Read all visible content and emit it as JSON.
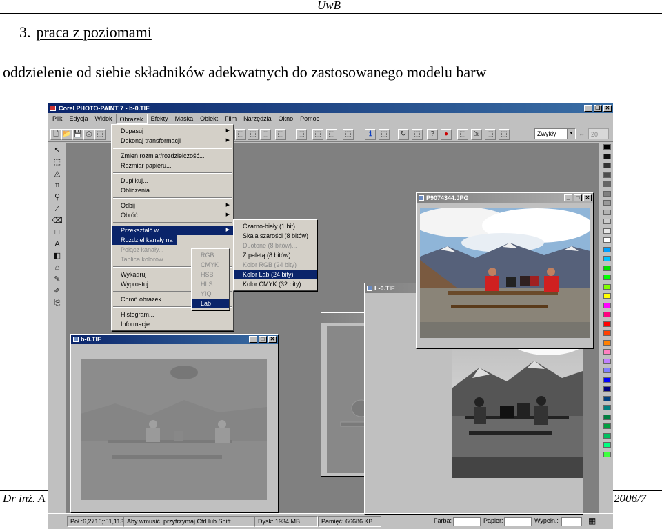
{
  "slide": {
    "header": "UwB",
    "section_number": "3.",
    "section_title": "praca z poziomami",
    "subtitle": "oddzielenie od siebie składników adekwatnych do zastosowanego modelu barw",
    "footer_left": "Dr inż. A",
    "footer_right": "2006/7"
  },
  "app": {
    "title": "Corel PHOTO-PAINT 7 - b-0.TIF",
    "menus": [
      "Plik",
      "Edycja",
      "Widok",
      "Obrazek",
      "Efekty",
      "Maska",
      "Obiekt",
      "Film",
      "Narzędzia",
      "Okno",
      "Pomoc"
    ],
    "active_menu": "Obrazek",
    "zoom_value": "Zwykły",
    "mask_field_value": "20"
  },
  "image_menu": {
    "groups": [
      [
        {
          "label": "Dopasuj",
          "submenu": true
        },
        {
          "label": "Dokonaj transformacji",
          "submenu": true
        }
      ],
      [
        {
          "label": "Zmień rozmiar/rozdzielczość..."
        },
        {
          "label": "Rozmiar papieru..."
        }
      ],
      [
        {
          "label": "Duplikuj..."
        },
        {
          "label": "Obliczenia..."
        }
      ],
      [
        {
          "label": "Odbij",
          "submenu": true
        },
        {
          "label": "Obróć",
          "submenu": true
        }
      ],
      [
        {
          "label": "Przekształć w",
          "submenu": true,
          "highlighted": true
        },
        {
          "label": "Rozdziel kanały na",
          "highlighted": true
        },
        {
          "label": "Połącz kanały...",
          "disabled": true
        },
        {
          "label": "Tablica kolorów...",
          "disabled": true
        }
      ],
      [
        {
          "label": "Wykadruj"
        },
        {
          "label": "Wyprostuj"
        }
      ],
      [
        {
          "label": "Chroń obrazek"
        }
      ],
      [
        {
          "label": "Histogram..."
        },
        {
          "label": "Informacje..."
        }
      ]
    ]
  },
  "split_submenu": {
    "items": [
      {
        "label": "RGB",
        "disabled": true
      },
      {
        "label": "CMYK",
        "disabled": true
      },
      {
        "label": "HSB",
        "disabled": true
      },
      {
        "label": "HLS",
        "disabled": true
      },
      {
        "label": "YIQ",
        "disabled": true
      },
      {
        "label": "Lab",
        "highlighted": true
      }
    ]
  },
  "convert_submenu": {
    "items": [
      {
        "label": "Czarno-biały (1 bit)"
      },
      {
        "label": "Skala szarości (8 bitów)"
      },
      {
        "label": "Duotone (8 bitów)...",
        "disabled": true
      },
      {
        "label": "Z paletą (8 bitów)..."
      },
      {
        "label": "Kolor RGB (24 bity)",
        "disabled": true
      },
      {
        "label": "Kolor Lab (24 bity)",
        "highlighted": true
      },
      {
        "label": "Kolor CMYK (32 bity)"
      }
    ]
  },
  "documents": {
    "photo": {
      "title": "P9074344.JPG"
    },
    "l_channel": {
      "title": "L-0.TIF"
    },
    "a_channel": {
      "title": ""
    },
    "b_channel": {
      "title": "b-0.TIF"
    }
  },
  "status": {
    "position": "Poł.:6,2716;:51,1136",
    "hint": "Aby wmusić, przytrzymaj Ctrl lub Shift",
    "disk": "Dysk: 1934 MB",
    "memory": "Pamięć: 66686 KB",
    "fill_label": "Farba:",
    "paper_label": "Papier:",
    "outline_label": "Wypełn.:"
  },
  "palette_colors": [
    "#000000",
    "#111111",
    "#333333",
    "#4d4d4d",
    "#666666",
    "#808080",
    "#999999",
    "#b3b3b3",
    "#cccccc",
    "#e6e6e6",
    "#ffffff",
    "#00a0ff",
    "#00c0ff",
    "#00e000",
    "#00ff00",
    "#80ff00",
    "#ffff00",
    "#ff00ff",
    "#ff0080",
    "#ff0000",
    "#ff4000",
    "#ff8000",
    "#ff80c0",
    "#c080ff",
    "#8080ff",
    "#0000ff",
    "#000080",
    "#004080",
    "#008080",
    "#008040",
    "#00a040",
    "#00c060",
    "#00ff80",
    "#40ff40"
  ]
}
